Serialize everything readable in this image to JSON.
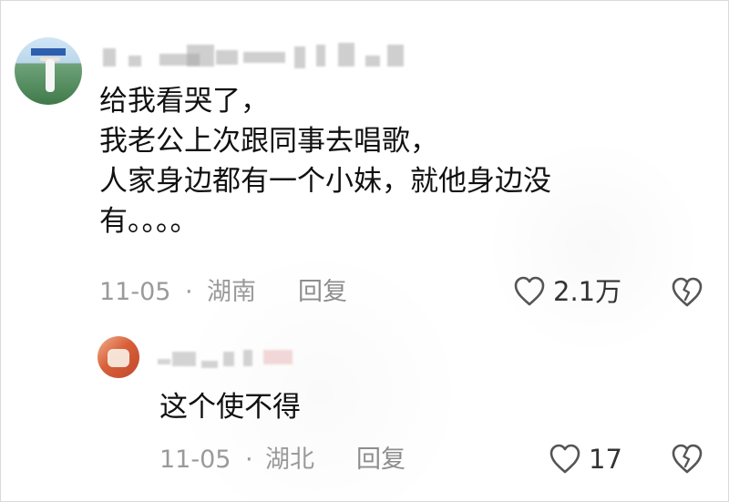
{
  "comment": {
    "lines": [
      "给我看哭了，",
      "我老公上次跟同事去唱歌，",
      "人家身边都有一个小妹，就他身边没",
      "有。。。。"
    ],
    "date": "11-05",
    "dot": "·",
    "location": "湖南",
    "reply_label": "回复",
    "like_count": "2.1万",
    "icons": {
      "avatar": "user-avatar",
      "like": "heart-icon",
      "dislike": "broken-heart-icon"
    }
  },
  "reply": {
    "text": "这个使不得",
    "date": "11-05",
    "dot": "·",
    "location": "湖北",
    "reply_label": "回复",
    "like_count": "17",
    "icons": {
      "avatar": "user-avatar",
      "like": "heart-icon",
      "dislike": "broken-heart-icon"
    }
  },
  "colors": {
    "text": "#111111",
    "meta": "#9a9a9a",
    "icon": "#555555"
  }
}
